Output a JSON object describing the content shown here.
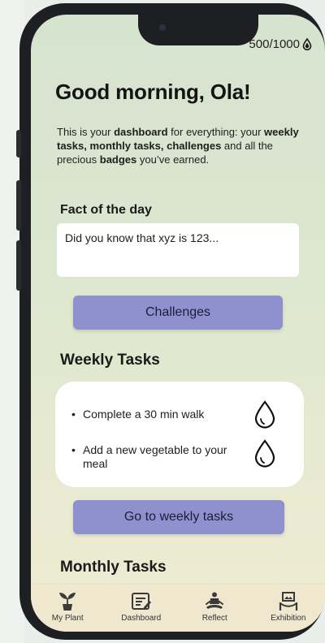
{
  "status": {
    "points": "500/1000",
    "points_icon": "water-drop-icon"
  },
  "greeting": "Good morning, Ola!",
  "intro": {
    "p1": "This is your ",
    "b1": "dashboard",
    "p2": " for everything: your ",
    "b2": "weekly tasks, monthly tasks, challenges",
    "p3": " and all the precious ",
    "b3": "badges",
    "p4": " you’ve earned."
  },
  "fact": {
    "title": "Fact of the day",
    "text": "Did you know that xyz is 123..."
  },
  "challenges_button": "Challenges",
  "weekly": {
    "title": "Weekly Tasks",
    "tasks": [
      {
        "text": "Complete a 30 min walk",
        "icon": "water-drop-icon"
      },
      {
        "text": "Add a new vegetable to your meal",
        "icon": "water-drop-icon"
      }
    ],
    "button": "Go to weekly tasks"
  },
  "monthly": {
    "title": "Monthly Tasks"
  },
  "tabs": [
    {
      "label": "My Plant",
      "icon": "plant-icon"
    },
    {
      "label": "Dashboard",
      "icon": "dashboard-icon"
    },
    {
      "label": "Reflect",
      "icon": "meditation-icon"
    },
    {
      "label": "Exhibition",
      "icon": "exhibition-icon"
    }
  ],
  "colors": {
    "accent": "#8e91cd",
    "background_top": "#d6e3cf",
    "background_bottom": "#efecd4"
  }
}
